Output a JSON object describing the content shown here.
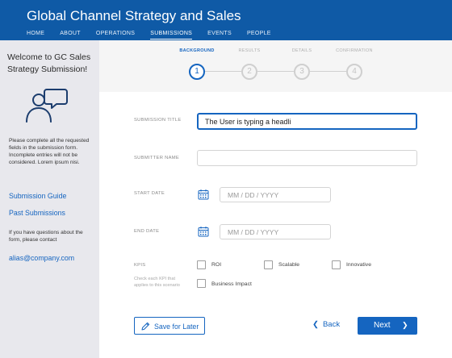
{
  "app": {
    "title": "Global Channel Strategy and Sales"
  },
  "nav": [
    "HOME",
    "ABOUT",
    "OPERATIONS",
    "SUBMISSIONS",
    "EVENTS",
    "PEOPLE"
  ],
  "nav_active": "SUBMISSIONS",
  "sidebar": {
    "welcome": "Welcome to GC Sales Strategy Submission!",
    "instructions": "Please complete all the requested fields in the submission form. Incomplete entries will not be considered. Lorem ipsum nisi.",
    "links": [
      "Submission Guide",
      "Past Submissions"
    ],
    "contact_text": "If you have questions about the form, please contact",
    "email": "alias@company.com"
  },
  "steps": [
    {
      "label": "BACKGROUND",
      "number": "1",
      "active": true
    },
    {
      "label": "RESULTS",
      "number": "2",
      "active": false
    },
    {
      "label": "DETAILS",
      "number": "3",
      "active": false
    },
    {
      "label": "CONFIRMATION",
      "number": "4",
      "active": false
    }
  ],
  "form": {
    "title_label": "SUBMISSION TITLE",
    "title_value": "The User is typing a headli",
    "submitter_label": "SUBMITTER NAME",
    "submitter_value": "",
    "start_label": "START DATE",
    "start_placeholder": "MM / DD / YYYY",
    "end_label": "END DATE",
    "end_placeholder": "MM / DD / YYYY",
    "kpis_label": "KPIS",
    "kpis_note": "Check each KPI that applies to this scenario",
    "kpis": [
      "ROI",
      "Scalable",
      "Innovative",
      "Business Impact"
    ]
  },
  "buttons": {
    "save": "Save for Later",
    "back": "Back",
    "next": "Next"
  },
  "colors": {
    "primary": "#1565c0",
    "header": "#0f5aa6",
    "sidebar": "#e8e8ed"
  }
}
